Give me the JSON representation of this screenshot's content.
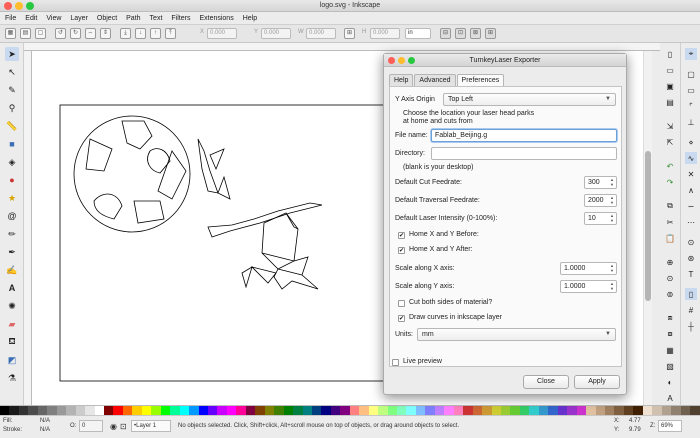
{
  "window": {
    "title": "logo.svg - Inkscape"
  },
  "menu": [
    "File",
    "Edit",
    "View",
    "Layer",
    "Object",
    "Path",
    "Text",
    "Filters",
    "Extensions",
    "Help"
  ],
  "toolbar": {
    "x_label": "X",
    "x_value": "0.000",
    "y_label": "Y",
    "y_value": "0.000",
    "w_label": "W",
    "w_value": "0.000",
    "h_label": "H",
    "h_value": "0.000",
    "unit": "in"
  },
  "left_tools": [
    "selector-icon",
    "node-icon",
    "tweak-icon",
    "zoom-icon",
    "measure-icon",
    "rect-icon",
    "3dbox-icon",
    "ellipse-icon",
    "star-icon",
    "spiral-icon",
    "pencil-icon",
    "pen-icon",
    "calligraphy-icon",
    "text-icon",
    "spray-icon",
    "eraser-icon",
    "bucket-icon",
    "gradient-icon",
    "dropper-icon"
  ],
  "dialog": {
    "title": "TurnkeyLaser Exporter",
    "tabs": [
      "Help",
      "Advanced",
      "Preferences"
    ],
    "active_tab": "Preferences",
    "y_axis_label": "Y Axis Origin",
    "y_axis_value": "Top Left",
    "park_note_1": "Choose the location your laser head parks",
    "park_note_2": "at home and cuts from",
    "file_name_label": "File name:",
    "file_name_value": "Fablab_Beijing.g",
    "directory_label": "Directory:",
    "directory_value": "",
    "directory_note": "(blank is your desktop)",
    "cut_feed_label": "Default Cut Feedrate:",
    "cut_feed_value": "300",
    "traverse_feed_label": "Default Traversal Feedrate:",
    "traverse_feed_value": "2000",
    "intensity_label": "Default Laser Intensity (0-100%):",
    "intensity_value": "10",
    "home_before_label": "Home X and Y Before:",
    "home_before_checked": true,
    "home_after_label": "Home X and Y After:",
    "home_after_checked": true,
    "scale_x_label": "Scale along X axis:",
    "scale_x_value": "1.0000",
    "scale_y_label": "Scale along Y axis:",
    "scale_y_value": "1.0000",
    "cut_both_label": "Cut both sides of material?",
    "cut_both_checked": false,
    "draw_curves_label": "Draw curves in inkscape layer",
    "draw_curves_checked": true,
    "units_label": "Units:",
    "units_value": "mm",
    "live_preview_label": "Live preview",
    "live_preview_checked": false,
    "close_label": "Close",
    "apply_label": "Apply"
  },
  "status": {
    "fill_label": "Fill:",
    "fill_value": "N/A",
    "stroke_label": "Stroke:",
    "stroke_value": "N/A",
    "opacity_label": "O:",
    "opacity_value": "0",
    "layer_value": "•Layer 1",
    "message": "No objects selected. Click, Shift+click, Alt+scroll mouse on top of objects, or drag around objects to select.",
    "x_label": "X:",
    "x_value": "4.77",
    "y_label": "Y:",
    "y_value": "9.79",
    "z_label": "Z:",
    "zoom_value": "69%"
  },
  "palette": [
    "#000000",
    "#1a1a1a",
    "#333333",
    "#4d4d4d",
    "#666666",
    "#808080",
    "#999999",
    "#b3b3b3",
    "#cccccc",
    "#e6e6e6",
    "#ffffff",
    "#800000",
    "#ff0000",
    "#ff6600",
    "#ffcc00",
    "#ffff00",
    "#99ff00",
    "#00ff00",
    "#00ff99",
    "#00ffff",
    "#0099ff",
    "#0000ff",
    "#6600ff",
    "#cc00ff",
    "#ff00ff",
    "#ff0099",
    "#800040",
    "#804000",
    "#808000",
    "#408000",
    "#008000",
    "#008040",
    "#008080",
    "#004080",
    "#000080",
    "#400080",
    "#800080",
    "#ff8080",
    "#ffbf80",
    "#ffff80",
    "#bfff80",
    "#80ff80",
    "#80ffbf",
    "#80ffff",
    "#80bfff",
    "#8080ff",
    "#bf80ff",
    "#ff80ff",
    "#ff80bf",
    "#cc3333",
    "#cc6633",
    "#cc9933",
    "#cccc33",
    "#99cc33",
    "#66cc33",
    "#33cc66",
    "#33cccc",
    "#3399cc",
    "#3366cc",
    "#6633cc",
    "#9933cc",
    "#cc33cc",
    "#e0c0a0",
    "#c0a080",
    "#a08060",
    "#806040",
    "#604020",
    "#402000",
    "#f0e0d0",
    "#d0c0b0",
    "#b0a090",
    "#908070",
    "#706050",
    "#504030"
  ]
}
